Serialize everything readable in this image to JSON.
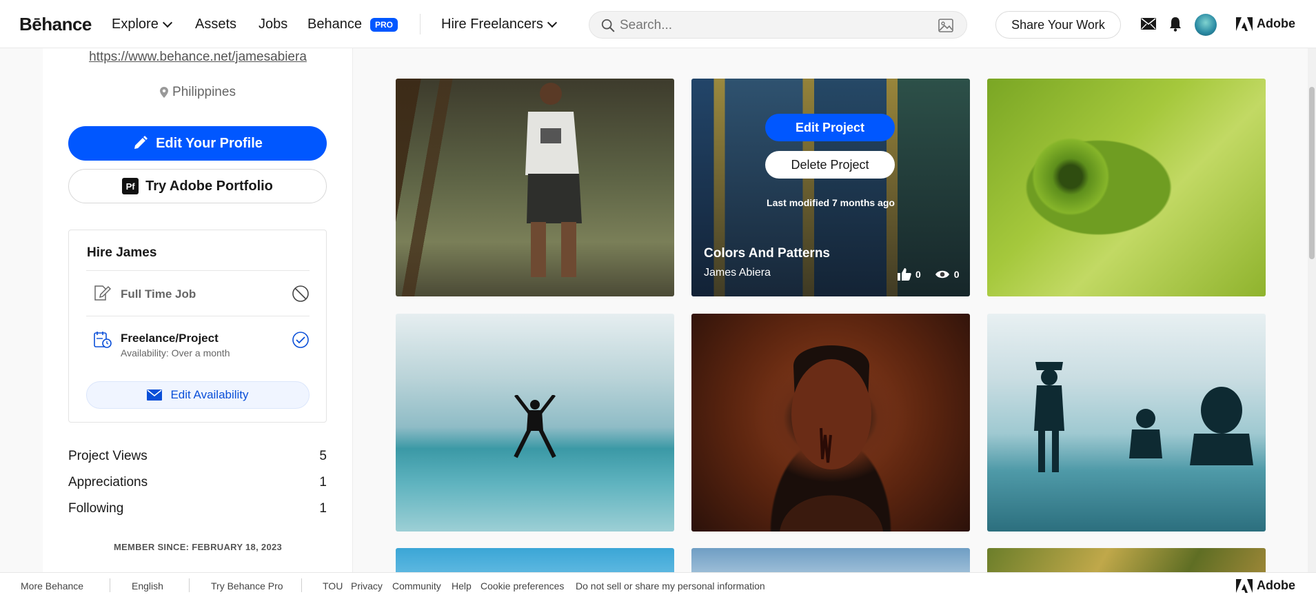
{
  "nav": {
    "logo": "Bēhance",
    "explore": "Explore",
    "assets": "Assets",
    "jobs": "Jobs",
    "behance": "Behance",
    "pro_badge": "PRO",
    "hire_freelancers": "Hire Freelancers",
    "search_placeholder": "Search...",
    "share_work": "Share Your Work",
    "adobe": "Adobe"
  },
  "profile": {
    "url": "https://www.behance.net/jamesabiera",
    "location": "Philippines",
    "edit_profile": "Edit Your Profile",
    "portfolio_badge": "Pf",
    "try_portfolio": "Try Adobe Portfolio"
  },
  "hire": {
    "title": "Hire James",
    "full_time": "Full Time Job",
    "freelance": "Freelance/Project",
    "freelance_sub": "Availability: Over a month",
    "edit_availability": "Edit Availability"
  },
  "stats": [
    {
      "label": "Project Views",
      "value": "5"
    },
    {
      "label": "Appreciations",
      "value": "1"
    },
    {
      "label": "Following",
      "value": "1"
    }
  ],
  "member_since": "MEMBER SINCE: FEBRUARY 18, 2023",
  "project_overlay": {
    "edit": "Edit Project",
    "delete": "Delete Project",
    "modified": "Last modified 7 months ago",
    "title": "Colors And Patterns",
    "owner": "James Abiera",
    "likes": "0",
    "views": "0"
  },
  "footer": {
    "more_behance": "More Behance",
    "english": "English",
    "try_pro": "Try Behance Pro",
    "tou": "TOU",
    "privacy": "Privacy",
    "community": "Community",
    "help": "Help",
    "cookie": "Cookie preferences",
    "do_not_sell": "Do not sell or share my personal information",
    "adobe": "Adobe"
  },
  "colors": {
    "accent": "#0057ff"
  }
}
